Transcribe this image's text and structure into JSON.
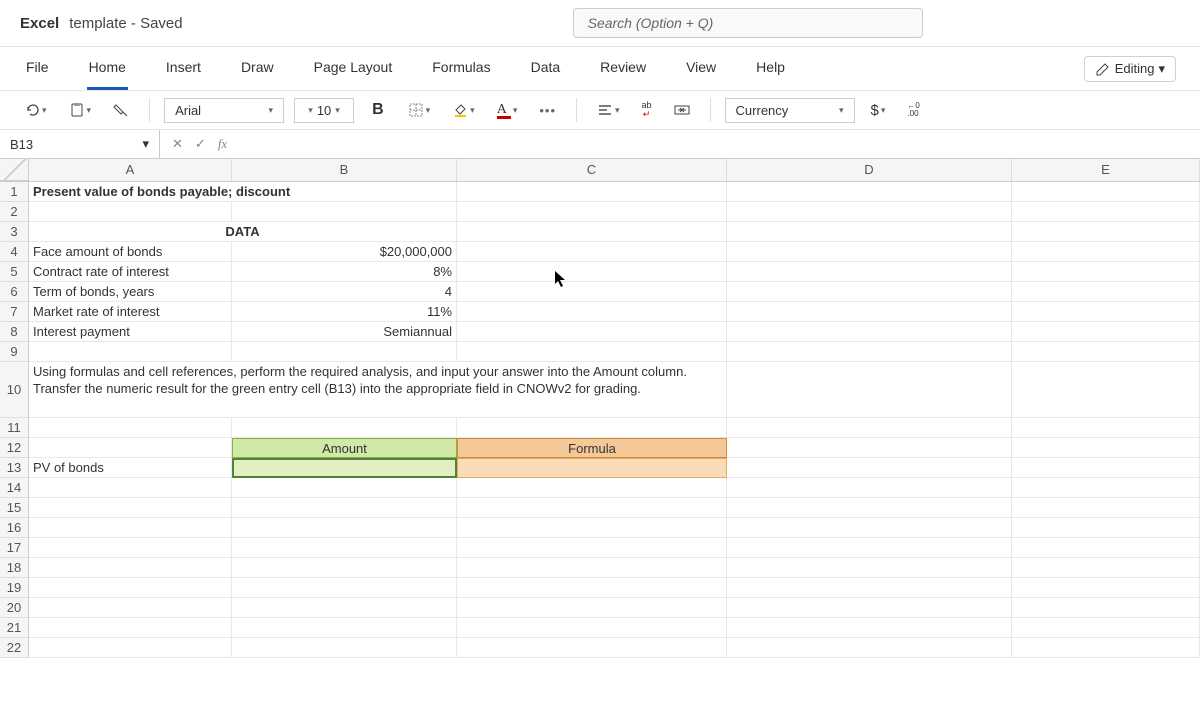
{
  "titlebar": {
    "app": "Excel",
    "doc": "template - Saved",
    "search_placeholder": "Search (Option + Q)"
  },
  "tabs": {
    "file": "File",
    "home": "Home",
    "insert": "Insert",
    "draw": "Draw",
    "pagelayout": "Page Layout",
    "formulas": "Formulas",
    "data": "Data",
    "review": "Review",
    "view": "View",
    "help": "Help",
    "editing": "Editing"
  },
  "toolbar": {
    "font": "Arial",
    "size": "10",
    "bold": "B",
    "currency_label": "Currency",
    "dollar": "$",
    "dec_top": "←0",
    "dec_bot": ".00"
  },
  "formulabar": {
    "namebox": "B13",
    "fx": "fx"
  },
  "cols": {
    "A_w": 203,
    "B_w": 225,
    "C_w": 270,
    "D_w": 285,
    "E_w": 188
  },
  "columns": [
    "A",
    "B",
    "C",
    "D",
    "E"
  ],
  "rows": [
    "1",
    "2",
    "3",
    "4",
    "5",
    "6",
    "7",
    "8",
    "9",
    "10",
    "11",
    "12",
    "13",
    "14",
    "15",
    "16",
    "17",
    "18",
    "19",
    "20",
    "21",
    "22"
  ],
  "sheet": {
    "r1A": "Present value of bonds payable; discount",
    "r3A": "DATA",
    "r4A": "Face amount of bonds",
    "r4B": "$20,000,000",
    "r5A": "Contract rate of interest",
    "r5B": "8%",
    "r6A": "Term of bonds, years",
    "r6B": "4",
    "r7A": "Market rate of interest",
    "r7B": "11%",
    "r8A": "Interest payment",
    "r8B": "Semiannual",
    "r10": "Using formulas and cell references, perform the required analysis, and input your answer into the Amount column. Transfer the numeric result for the green entry cell (B13) into the appropriate field in CNOWv2 for grading.",
    "r12B": "Amount",
    "r12C": "Formula",
    "r13A": "PV of bonds"
  }
}
